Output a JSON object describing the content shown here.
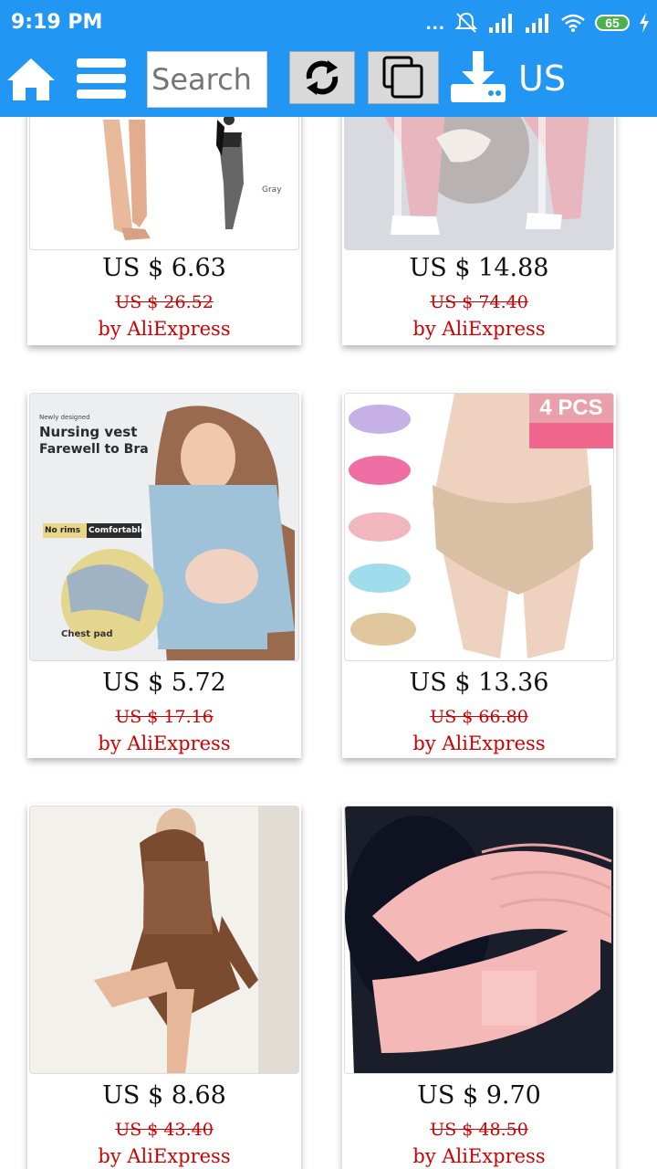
{
  "status_bar": {
    "time": "9:19 PM",
    "dots": "...",
    "battery": "65"
  },
  "toolbar": {
    "search_placeholder": "Search",
    "region": "US",
    "icons": [
      "home-icon",
      "menu-icon",
      "refresh-icon",
      "copy-icon",
      "download-icon"
    ]
  },
  "products": [
    {
      "price": "US $ 6.63",
      "original_price": "US $ 26.52",
      "source": "by AliExpress",
      "image_text": "Gray"
    },
    {
      "price": "US $ 14.88",
      "original_price": "US $ 74.40",
      "source": "by AliExpress"
    },
    {
      "price": "US $ 5.72",
      "original_price": "US $ 17.16",
      "source": "by AliExpress",
      "image_text": {
        "small": "Newly designed",
        "line1": "Nursing vest",
        "line2": "Farewell to Bra",
        "tag1": "No rims",
        "tag2": "Comfortable",
        "pad": "Chest pad"
      }
    },
    {
      "price": "US $ 13.36",
      "original_price": "US $ 66.80",
      "source": "by AliExpress",
      "badge": "4 PCS"
    },
    {
      "price": "US $ 8.68",
      "original_price": "US $ 43.40",
      "source": "by AliExpress"
    },
    {
      "price": "US $ 9.70",
      "original_price": "US $ 48.50",
      "source": "by AliExpress"
    }
  ],
  "colors": {
    "primary": "#2196F3",
    "price_strike": "#d10000"
  }
}
